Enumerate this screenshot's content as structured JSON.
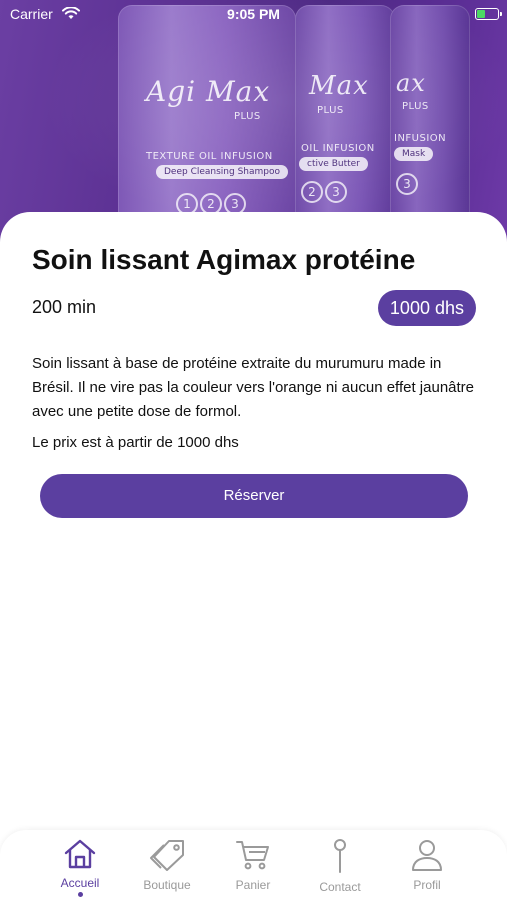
{
  "status_bar": {
    "carrier": "Carrier",
    "time": "9:05 PM"
  },
  "hero": {
    "brand": "Agi Max",
    "brand_sub": "PLUS",
    "line1": "TEXTURE OIL INFUSION",
    "tag1": "Deep Cleansing Shampoo",
    "line2": "OIL INFUSION",
    "tag2": "ctive Butter",
    "line3": "INFUSION",
    "tag3": "Mask",
    "nums": [
      "1",
      "2",
      "3"
    ]
  },
  "service": {
    "title": "Soin lissant Agimax protéine",
    "duration": "200 min",
    "price": "1000 dhs",
    "description": "Soin lissant à base de protéine extraite du murumuru made in Brésil. Il ne vire pas la couleur vers l'orange ni aucun effet jaunâtre avec une petite dose de formol.",
    "price_note": "Le prix est à partir de 1000 dhs",
    "reserve_label": "Réserver"
  },
  "tabs": [
    {
      "label": "Accueil",
      "icon": "home-icon",
      "active": true
    },
    {
      "label": "Boutique",
      "icon": "tag-icon",
      "active": false
    },
    {
      "label": "Panier",
      "icon": "cart-icon",
      "active": false
    },
    {
      "label": "Contact",
      "icon": "location-pin-icon",
      "active": false
    },
    {
      "label": "Profil",
      "icon": "user-icon",
      "active": false
    }
  ],
  "colors": {
    "accent": "#5b3fa0",
    "inactive": "#9a9a9a",
    "battery": "#4cd964"
  }
}
